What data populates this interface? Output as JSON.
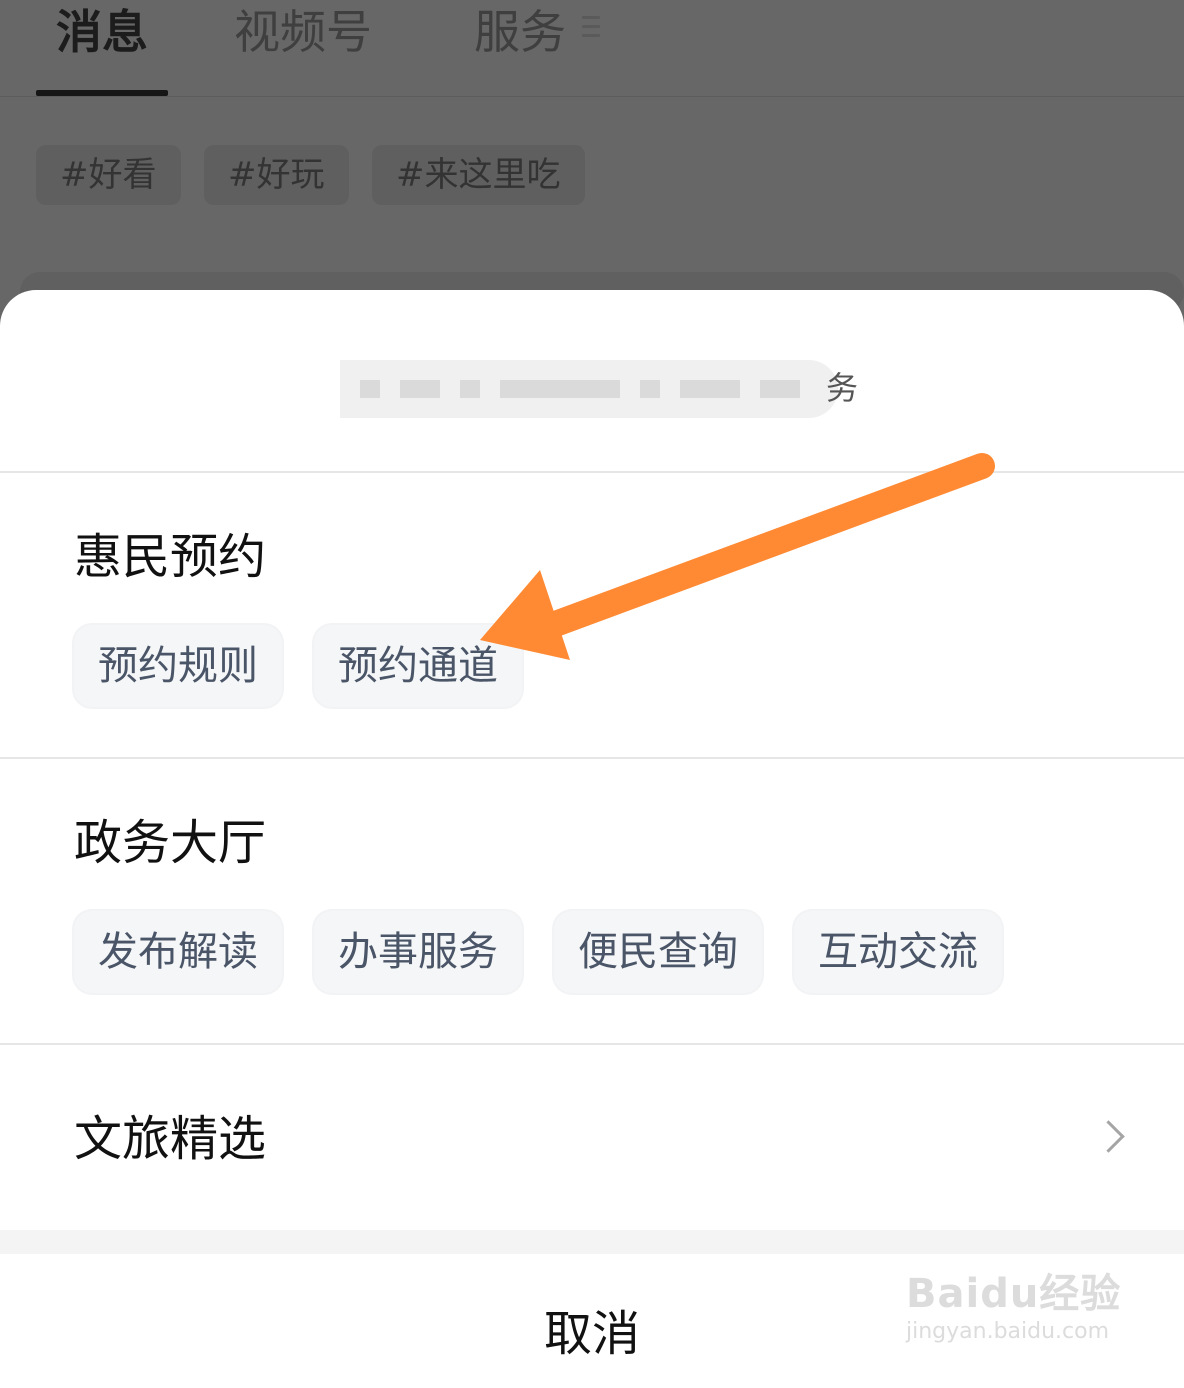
{
  "background": {
    "tabs": [
      {
        "label": "消息",
        "active": true
      },
      {
        "label": "视频号",
        "active": false
      },
      {
        "label": "服务",
        "active": false
      }
    ],
    "hashtags": [
      "#好看",
      "#好玩",
      "#来这里吃"
    ]
  },
  "sheet": {
    "title_tail": "务",
    "sections": [
      {
        "title": "惠民预约",
        "chips": [
          "预约规则",
          "预约通道"
        ]
      },
      {
        "title": "政务大厅",
        "chips": [
          "发布解读",
          "办事服务",
          "便民查询",
          "互动交流"
        ]
      },
      {
        "title": "文旅精选"
      }
    ],
    "cancel_label": "取消"
  },
  "annotation": {
    "arrow_color": "#ff8a33",
    "arrow_points_to": "预约通道"
  },
  "watermark": {
    "logo": "Baidu经验",
    "url": "jingyan.baidu.com"
  },
  "colors": {
    "overlay": "#676767",
    "chip_bg": "#f5f6f7",
    "chip_text": "#4a5568",
    "divider": "#e6e6e6"
  }
}
